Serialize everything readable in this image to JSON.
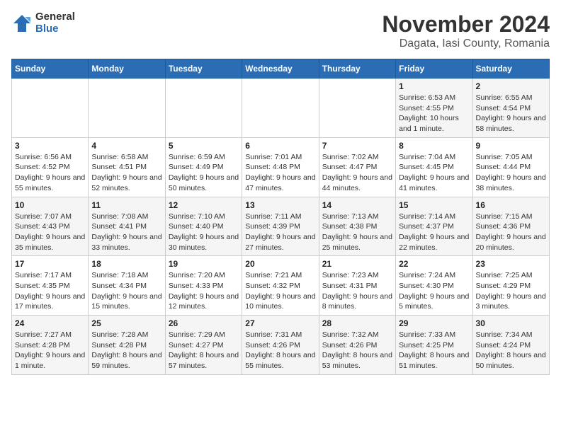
{
  "logo": {
    "general": "General",
    "blue": "Blue"
  },
  "title": "November 2024",
  "subtitle": "Dagata, Iasi County, Romania",
  "weekdays": [
    "Sunday",
    "Monday",
    "Tuesday",
    "Wednesday",
    "Thursday",
    "Friday",
    "Saturday"
  ],
  "weeks": [
    [
      {
        "day": "",
        "detail": ""
      },
      {
        "day": "",
        "detail": ""
      },
      {
        "day": "",
        "detail": ""
      },
      {
        "day": "",
        "detail": ""
      },
      {
        "day": "",
        "detail": ""
      },
      {
        "day": "1",
        "detail": "Sunrise: 6:53 AM\nSunset: 4:55 PM\nDaylight: 10 hours and 1 minute."
      },
      {
        "day": "2",
        "detail": "Sunrise: 6:55 AM\nSunset: 4:54 PM\nDaylight: 9 hours and 58 minutes."
      }
    ],
    [
      {
        "day": "3",
        "detail": "Sunrise: 6:56 AM\nSunset: 4:52 PM\nDaylight: 9 hours and 55 minutes."
      },
      {
        "day": "4",
        "detail": "Sunrise: 6:58 AM\nSunset: 4:51 PM\nDaylight: 9 hours and 52 minutes."
      },
      {
        "day": "5",
        "detail": "Sunrise: 6:59 AM\nSunset: 4:49 PM\nDaylight: 9 hours and 50 minutes."
      },
      {
        "day": "6",
        "detail": "Sunrise: 7:01 AM\nSunset: 4:48 PM\nDaylight: 9 hours and 47 minutes."
      },
      {
        "day": "7",
        "detail": "Sunrise: 7:02 AM\nSunset: 4:47 PM\nDaylight: 9 hours and 44 minutes."
      },
      {
        "day": "8",
        "detail": "Sunrise: 7:04 AM\nSunset: 4:45 PM\nDaylight: 9 hours and 41 minutes."
      },
      {
        "day": "9",
        "detail": "Sunrise: 7:05 AM\nSunset: 4:44 PM\nDaylight: 9 hours and 38 minutes."
      }
    ],
    [
      {
        "day": "10",
        "detail": "Sunrise: 7:07 AM\nSunset: 4:43 PM\nDaylight: 9 hours and 35 minutes."
      },
      {
        "day": "11",
        "detail": "Sunrise: 7:08 AM\nSunset: 4:41 PM\nDaylight: 9 hours and 33 minutes."
      },
      {
        "day": "12",
        "detail": "Sunrise: 7:10 AM\nSunset: 4:40 PM\nDaylight: 9 hours and 30 minutes."
      },
      {
        "day": "13",
        "detail": "Sunrise: 7:11 AM\nSunset: 4:39 PM\nDaylight: 9 hours and 27 minutes."
      },
      {
        "day": "14",
        "detail": "Sunrise: 7:13 AM\nSunset: 4:38 PM\nDaylight: 9 hours and 25 minutes."
      },
      {
        "day": "15",
        "detail": "Sunrise: 7:14 AM\nSunset: 4:37 PM\nDaylight: 9 hours and 22 minutes."
      },
      {
        "day": "16",
        "detail": "Sunrise: 7:15 AM\nSunset: 4:36 PM\nDaylight: 9 hours and 20 minutes."
      }
    ],
    [
      {
        "day": "17",
        "detail": "Sunrise: 7:17 AM\nSunset: 4:35 PM\nDaylight: 9 hours and 17 minutes."
      },
      {
        "day": "18",
        "detail": "Sunrise: 7:18 AM\nSunset: 4:34 PM\nDaylight: 9 hours and 15 minutes."
      },
      {
        "day": "19",
        "detail": "Sunrise: 7:20 AM\nSunset: 4:33 PM\nDaylight: 9 hours and 12 minutes."
      },
      {
        "day": "20",
        "detail": "Sunrise: 7:21 AM\nSunset: 4:32 PM\nDaylight: 9 hours and 10 minutes."
      },
      {
        "day": "21",
        "detail": "Sunrise: 7:23 AM\nSunset: 4:31 PM\nDaylight: 9 hours and 8 minutes."
      },
      {
        "day": "22",
        "detail": "Sunrise: 7:24 AM\nSunset: 4:30 PM\nDaylight: 9 hours and 5 minutes."
      },
      {
        "day": "23",
        "detail": "Sunrise: 7:25 AM\nSunset: 4:29 PM\nDaylight: 9 hours and 3 minutes."
      }
    ],
    [
      {
        "day": "24",
        "detail": "Sunrise: 7:27 AM\nSunset: 4:28 PM\nDaylight: 9 hours and 1 minute."
      },
      {
        "day": "25",
        "detail": "Sunrise: 7:28 AM\nSunset: 4:28 PM\nDaylight: 8 hours and 59 minutes."
      },
      {
        "day": "26",
        "detail": "Sunrise: 7:29 AM\nSunset: 4:27 PM\nDaylight: 8 hours and 57 minutes."
      },
      {
        "day": "27",
        "detail": "Sunrise: 7:31 AM\nSunset: 4:26 PM\nDaylight: 8 hours and 55 minutes."
      },
      {
        "day": "28",
        "detail": "Sunrise: 7:32 AM\nSunset: 4:26 PM\nDaylight: 8 hours and 53 minutes."
      },
      {
        "day": "29",
        "detail": "Sunrise: 7:33 AM\nSunset: 4:25 PM\nDaylight: 8 hours and 51 minutes."
      },
      {
        "day": "30",
        "detail": "Sunrise: 7:34 AM\nSunset: 4:24 PM\nDaylight: 8 hours and 50 minutes."
      }
    ]
  ]
}
